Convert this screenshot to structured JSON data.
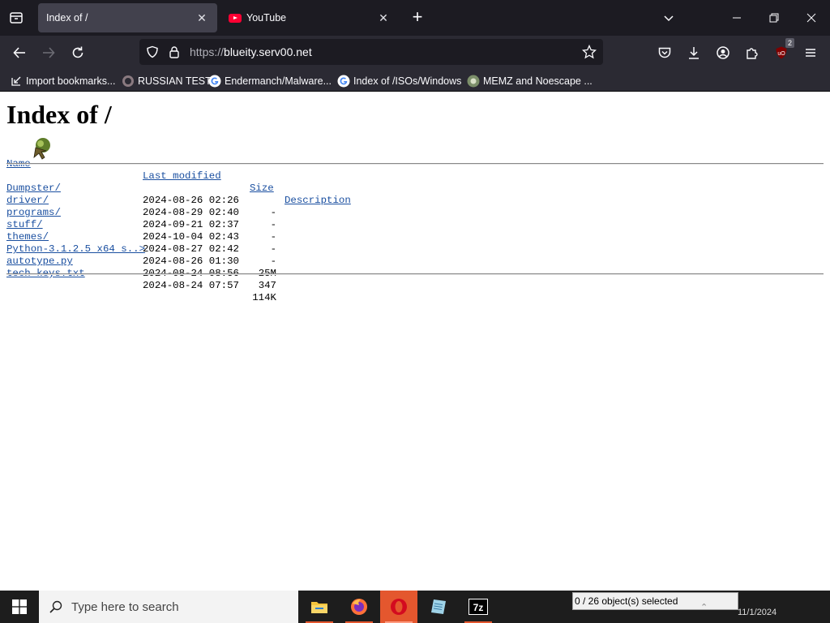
{
  "browser": {
    "tabs": [
      {
        "title": "Index of /",
        "active": true
      },
      {
        "title": "YouTube",
        "active": false
      }
    ],
    "url": {
      "scheme": "https://",
      "host": "blueity.serv00.net"
    },
    "extension_badge": "2",
    "bookmarks": [
      {
        "label": "Import bookmarks...",
        "icon": "import-icon"
      },
      {
        "label": "RUSSIAN TEST",
        "icon": "github-icon"
      },
      {
        "label": "Endermanch/Malware...",
        "icon": "google-icon"
      },
      {
        "label": "Index of /ISOs/Windows",
        "icon": "google-icon"
      },
      {
        "label": "MEMZ and Noescape ...",
        "icon": "site-icon"
      }
    ]
  },
  "page": {
    "title": "Index of /",
    "headers": {
      "name": "Name",
      "modified": "Last modified",
      "size": "Size",
      "description": "Description"
    },
    "entries": [
      {
        "name": "Dumpster/",
        "modified": "2024-08-26 02:26",
        "size": "-"
      },
      {
        "name": "driver/",
        "modified": "2024-08-29 02:40",
        "size": "-"
      },
      {
        "name": "programs/",
        "modified": "2024-09-21 02:37",
        "size": "-"
      },
      {
        "name": "stuff/",
        "modified": "2024-10-04 02:43",
        "size": "-"
      },
      {
        "name": "themes/",
        "modified": "2024-08-27 02:42",
        "size": "-"
      },
      {
        "name": "Python-3.1.2.5 x64 s..>",
        "modified": "2024-08-26 01:30",
        "size": "25M"
      },
      {
        "name": "autotype.py",
        "modified": "2024-08-24 08:56",
        "size": "347"
      },
      {
        "name": "tech keys.txt",
        "modified": "2024-08-24 07:57",
        "size": "114K"
      }
    ]
  },
  "taskbar": {
    "search_placeholder": "Type here to search",
    "apps": [
      "file-explorer-icon",
      "firefox-icon",
      "opera-icon",
      "notepad-icon",
      "7zip-icon"
    ],
    "status_popup": "0 / 26 object(s) selected",
    "date": "11/1/2024"
  },
  "colors": {
    "link": "#1a4fa0",
    "tabstrip": "#1c1b22",
    "toolbar": "#2b2a33",
    "taskbar": "#1d1d1d",
    "accent": "#e4572e"
  }
}
